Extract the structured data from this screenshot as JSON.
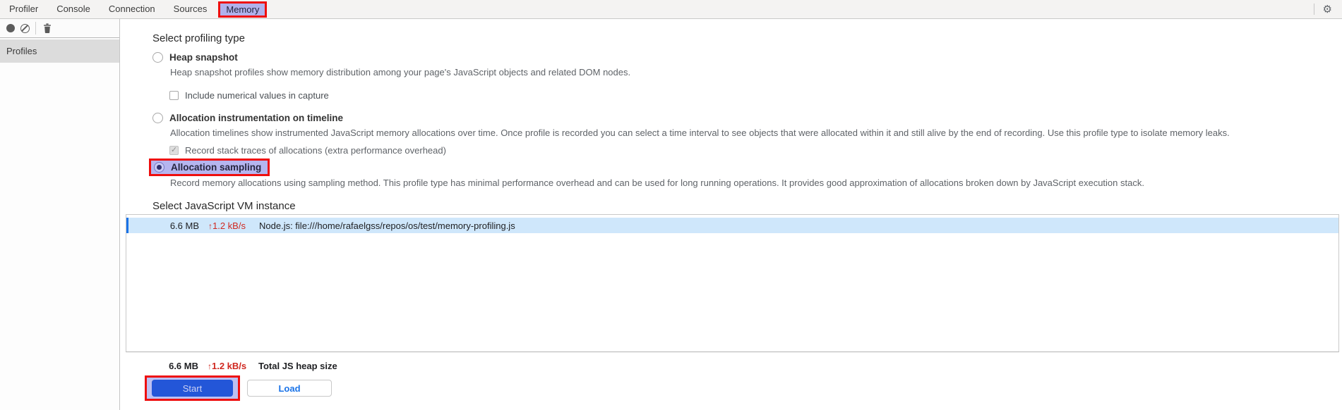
{
  "tabs": {
    "items": [
      {
        "label": "Profiler"
      },
      {
        "label": "Console"
      },
      {
        "label": "Connection"
      },
      {
        "label": "Sources"
      },
      {
        "label": "Memory"
      }
    ],
    "active_tab": "Memory"
  },
  "icons": {
    "gear": "⚙",
    "check": "✓",
    "up_arrow": "↑"
  },
  "sidebar": {
    "profiles_label": "Profiles"
  },
  "profiling": {
    "heading": "Select profiling type",
    "options": [
      {
        "label": "Heap snapshot",
        "description": "Heap snapshot profiles show memory distribution among your page's JavaScript objects and related DOM nodes.",
        "selected": false,
        "checkbox": {
          "label": "Include numerical values in capture",
          "checked": false
        }
      },
      {
        "label": "Allocation instrumentation on timeline",
        "description": "Allocation timelines show instrumented JavaScript memory allocations over time. Once profile is recorded you can select a time interval to see objects that were allocated within it and still alive by the end of recording. Use this profile type to isolate memory leaks.",
        "selected": false,
        "checkbox": {
          "label": "Record stack traces of allocations (extra performance overhead)",
          "checked": true,
          "disabled": true
        }
      },
      {
        "label": "Allocation sampling",
        "description": "Record memory allocations using sampling method. This profile type has minimal performance overhead and can be used for long running operations. It provides good approximation of allocations broken down by JavaScript execution stack.",
        "selected": true,
        "highlighted": true
      }
    ]
  },
  "vm": {
    "heading": "Select JavaScript VM instance",
    "instances": [
      {
        "size": "6.6 MB",
        "rate": "1.2 kB/s",
        "name": "Node.js: file:///home/rafaelgss/repos/os/test/memory-profiling.js",
        "selected": true
      }
    ],
    "total": {
      "size": "6.6 MB",
      "rate": "1.2 kB/s",
      "label": "Total JS heap size"
    }
  },
  "actions": {
    "start_label": "Start",
    "load_label": "Load"
  },
  "colors": {
    "highlight_red": "#ee0e0e",
    "highlight_fill": "#b5b5ef",
    "active_tab_fill": "#b1b1ec",
    "selected_row_bg": "#cfe7fb",
    "selected_row_bar": "#1a73e8",
    "rate_red": "#d02820",
    "start_button_bg": "#2356d8",
    "load_button_text": "#1a73e8"
  }
}
